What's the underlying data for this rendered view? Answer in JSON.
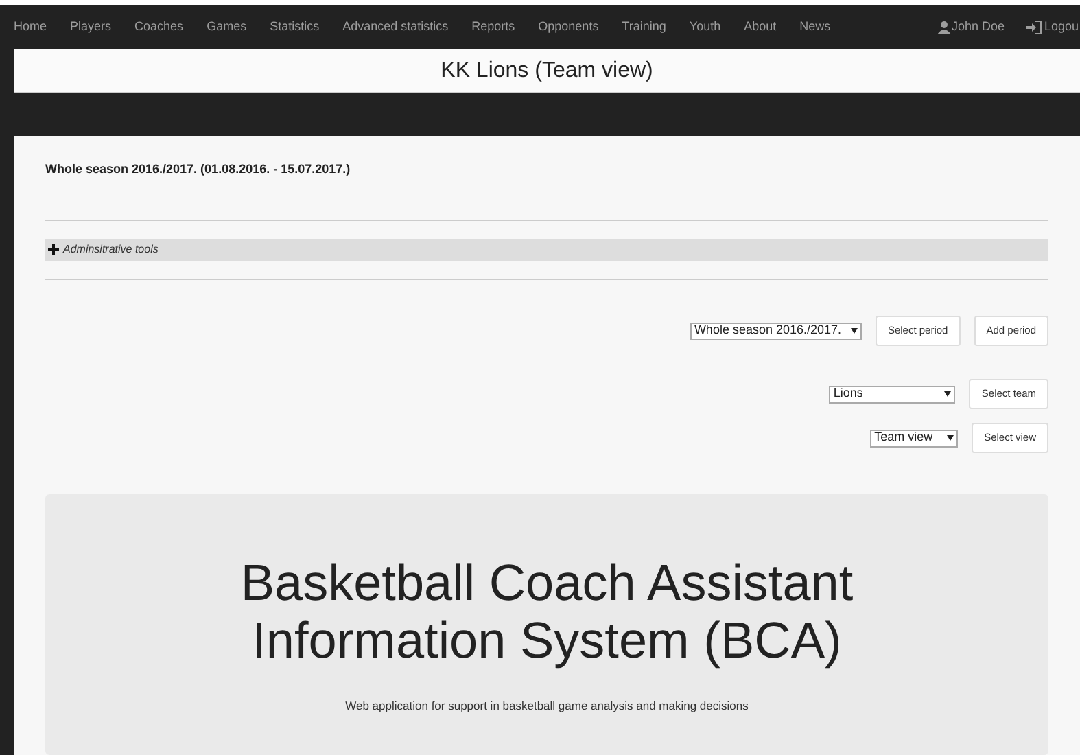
{
  "nav": {
    "items": [
      "Home",
      "Players",
      "Coaches",
      "Games",
      "Statistics",
      "Advanced statistics",
      "Reports",
      "Opponents",
      "Training",
      "Youth",
      "About",
      "News"
    ],
    "user": "John Doe",
    "logout": "Logou"
  },
  "page_title": "KK Lions (Team view)",
  "period_label": "Whole season 2016./2017. (01.08.2016. - 15.07.2017.)",
  "admin_tools": {
    "label": "Adminsitrative tools",
    "expanded": false
  },
  "controls": [
    {
      "select": "Whole season 2016./2017.",
      "buttons": [
        "Select period",
        "Add period"
      ]
    },
    {
      "select": "Lions",
      "buttons": [
        "Select team"
      ]
    },
    {
      "select": "Team view",
      "buttons": [
        "Select view"
      ]
    }
  ],
  "hero": {
    "title": "Basketball Coach Assistant Information System (BCA)",
    "subtitle": "Web application for support in basketball game analysis and making decisions"
  }
}
